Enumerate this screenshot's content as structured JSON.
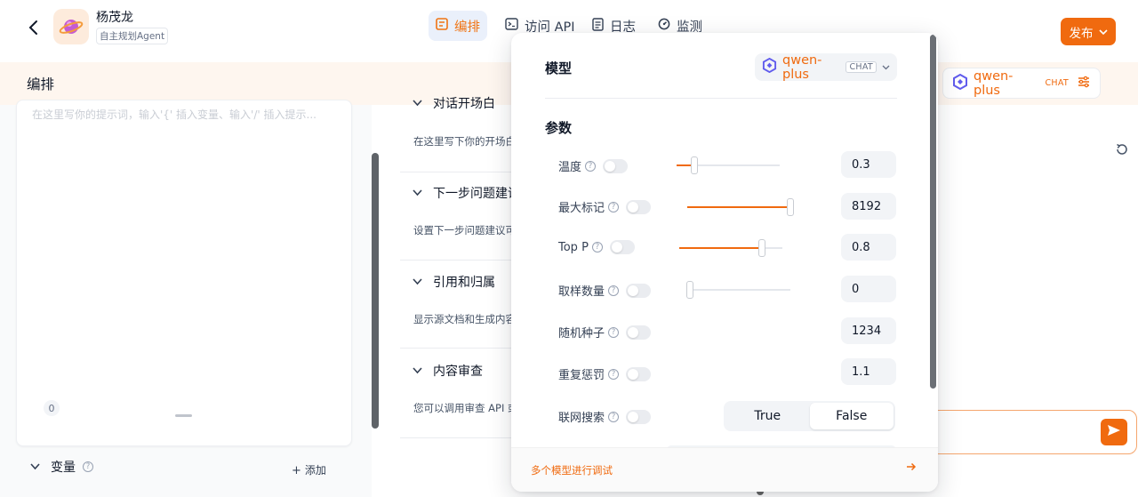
{
  "header": {
    "app_name": "杨茂龙",
    "app_type": "自主规划Agent",
    "tabs": [
      {
        "label": "编排",
        "active": true,
        "icon": "orchestrate-icon"
      },
      {
        "label": "访问 API",
        "active": false,
        "icon": "terminal-icon"
      },
      {
        "label": "日志",
        "active": false,
        "icon": "log-icon"
      },
      {
        "label": "监测",
        "active": false,
        "icon": "monitor-icon"
      }
    ],
    "publish_label": "发布"
  },
  "toolbar": {
    "title": "编排"
  },
  "prompt": {
    "placeholder": "在这里写你的提示词，输入'{' 插入变量、输入'/' 插入提示...",
    "char_count": "0"
  },
  "variables": {
    "title": "变量",
    "add_label": "添加"
  },
  "features": [
    {
      "title": "对话开场白",
      "desc": "在这里写下你的开场白"
    },
    {
      "title": "下一步问题建议",
      "desc": "设置下一步问题建议可"
    },
    {
      "title": "引用和归属",
      "desc": "显示源文档和生成内容"
    },
    {
      "title": "内容审查",
      "desc": "您可以调用审查 API 或"
    }
  ],
  "right_model": {
    "name": "qwen-plus",
    "mode": "CHAT"
  },
  "popover": {
    "model_title": "模型",
    "model_name": "qwen-plus",
    "model_mode": "CHAT",
    "params_title": "参数",
    "params": [
      {
        "label": "温度",
        "value": "0.3",
        "fraction": 0.17
      },
      {
        "label": "最大标记",
        "value": "8192",
        "fraction": 1.0
      },
      {
        "label": "Top P",
        "value": "0.8",
        "fraction": 0.8
      },
      {
        "label": "取样数量",
        "value": "0",
        "fraction": 0.0
      },
      {
        "label": "随机种子",
        "value": "1234"
      },
      {
        "label": "重复惩罚",
        "value": "1.1"
      },
      {
        "label": "联网搜索",
        "options": [
          "True",
          "False"
        ],
        "selected": "False"
      }
    ],
    "footer_link": "多个模型进行调试"
  },
  "colors": {
    "accent": "#f06a0f",
    "band": "#fef6ef"
  }
}
